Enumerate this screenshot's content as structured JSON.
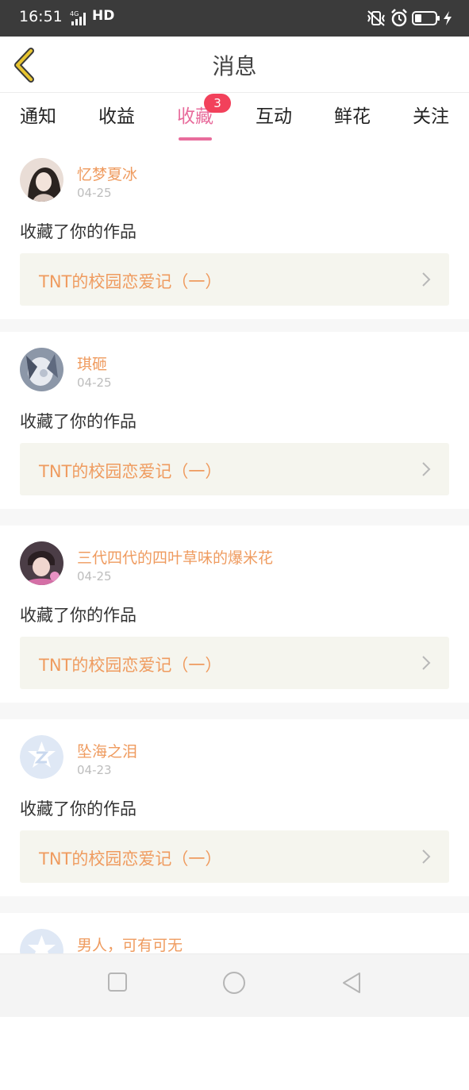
{
  "status_bar": {
    "time": "16:51",
    "network": "HD",
    "network_small": "4G",
    "icons": [
      "signal-icon",
      "mute-vibrate-icon",
      "alarm-icon",
      "battery-icon",
      "charging-icon"
    ]
  },
  "header": {
    "title": "消息",
    "back_icon": "chevron-left-icon"
  },
  "tabs": [
    {
      "label": "通知"
    },
    {
      "label": "收益"
    },
    {
      "label": "收藏",
      "active": true,
      "badge": "3"
    },
    {
      "label": "互动"
    },
    {
      "label": "鲜花"
    },
    {
      "label": "关注"
    }
  ],
  "messages": [
    {
      "username": "忆梦夏冰",
      "date": "04-25",
      "action": "收藏了你的作品",
      "work_title": "TNT的校园恋爱记（一）"
    },
    {
      "username": "琪砸",
      "date": "04-25",
      "action": "收藏了你的作品",
      "work_title": "TNT的校园恋爱记（一）"
    },
    {
      "username": "三代四代的四叶草味的爆米花",
      "date": "04-25",
      "action": "收藏了你的作品",
      "work_title": "TNT的校园恋爱记（一）"
    },
    {
      "username": "坠海之泪",
      "date": "04-23",
      "action": "收藏了你的作品",
      "work_title": "TNT的校园恋爱记（一）"
    },
    {
      "username": "男人，可有可无",
      "date": "",
      "action": "",
      "work_title": ""
    }
  ],
  "colors": {
    "accent_pink": "#e86c9c",
    "username_orange": "#ef9b5f",
    "badge_red": "#f2415b",
    "link_bg": "#f5f5ee",
    "back_arrow": "#e8c531"
  },
  "navbar": {
    "icons": [
      "square-recent-apps-icon",
      "circle-home-icon",
      "triangle-back-icon"
    ]
  }
}
